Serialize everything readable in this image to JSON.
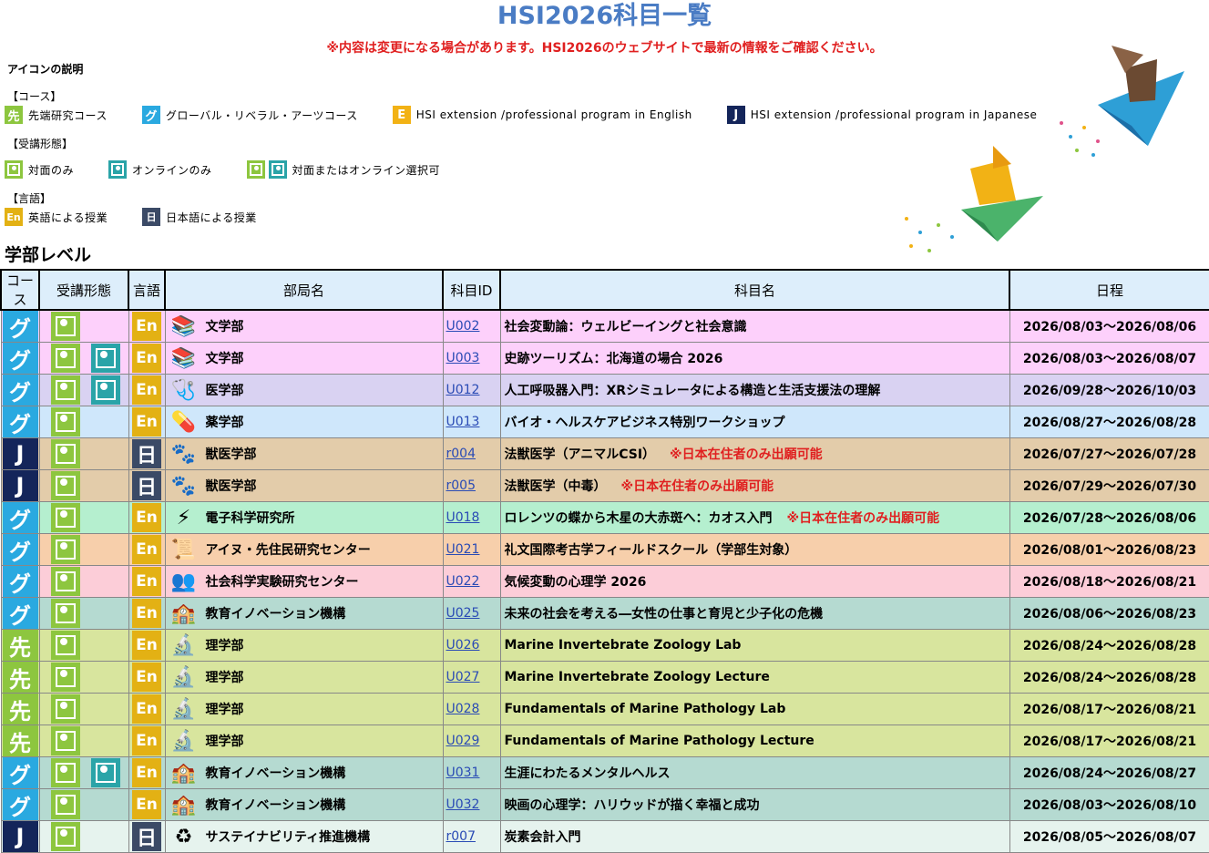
{
  "title": "HSI2026科目一覧",
  "notice": "※内容は変更になる場合があります。HSI2026のウェブサイトで最新の情報をご確認ください。",
  "legend": {
    "heading": "アイコンの説明",
    "course_section": "【コース】",
    "courses": [
      {
        "badge": "先",
        "label": "先端研究コース",
        "color": "#8dc63f"
      },
      {
        "badge": "グ",
        "label": "グローバル・リベラル・アーツコース",
        "color": "#2aa9e0"
      },
      {
        "badge": "E",
        "label": "HSI extension /professional program in English",
        "color": "#f2b215"
      },
      {
        "badge": "J",
        "label": "HSI extension /professional program in Japanese",
        "color": "#14255a"
      }
    ],
    "mode_section": "【受講形態】",
    "modes": [
      {
        "icon": "face-to-face-icon",
        "label": "対面のみ"
      },
      {
        "icon": "online-icon",
        "label": "オンラインのみ"
      },
      {
        "icon": "face-or-online-icon",
        "label": "対面またはオンライン選択可"
      }
    ],
    "lang_section": "【言語】",
    "languages": [
      {
        "badge": "En",
        "label": "英語による授業",
        "color": "#e3b114"
      },
      {
        "badge": "日",
        "label": "日本語による授業",
        "color": "#3b4a66"
      }
    ]
  },
  "section_title": "学部レベル",
  "table": {
    "headers": [
      "コース",
      "受講形態",
      "言語",
      "部局名",
      "科目ID",
      "科目名",
      "日程"
    ],
    "rows": [
      {
        "course": "グ",
        "online": false,
        "lang": "En",
        "dept_icon": "books-icon",
        "dept": "文学部",
        "id": "U002",
        "subject": "社会変動論：ウェルビーイングと社会意識",
        "note": "",
        "date": "2026/08/03～2026/08/06",
        "bg": "#fdd0fb"
      },
      {
        "course": "グ",
        "online": true,
        "lang": "En",
        "dept_icon": "books-icon",
        "dept": "文学部",
        "id": "U003",
        "subject": "史跡ツーリズム：北海道の場合 2026",
        "note": "",
        "date": "2026/08/03～2026/08/07",
        "bg": "#fdd0fb"
      },
      {
        "course": "グ",
        "online": true,
        "lang": "En",
        "dept_icon": "stethoscope-icon",
        "dept": "医学部",
        "id": "U012",
        "subject": "人工呼吸器入門：XRシミュレータによる構造と生活支援法の理解",
        "note": "",
        "date": "2026/09/28～2026/10/03",
        "bg": "#d9d2f2"
      },
      {
        "course": "グ",
        "online": false,
        "lang": "En",
        "dept_icon": "medicine-bottle-icon",
        "dept": "薬学部",
        "id": "U013",
        "subject": "バイオ・ヘルスケアビジネス特別ワークショップ",
        "note": "",
        "date": "2026/08/27～2026/08/28",
        "bg": "#cfe7fb"
      },
      {
        "course": "J",
        "online": false,
        "lang": "日",
        "dept_icon": "paw-icon",
        "dept": "獣医学部",
        "id": "r004",
        "subject": "法獣医学（アニマルCSI）",
        "note": "※日本在住者のみ出願可能",
        "date": "2026/07/27～2026/07/28",
        "bg": "#e3ccaa"
      },
      {
        "course": "J",
        "online": false,
        "lang": "日",
        "dept_icon": "paw-icon",
        "dept": "獣医学部",
        "id": "r005",
        "subject": "法獣医学（中毒）",
        "note": "※日本在住者のみ出願可能",
        "date": "2026/07/29～2026/07/30",
        "bg": "#e3ccaa"
      },
      {
        "course": "グ",
        "online": false,
        "lang": "En",
        "dept_icon": "circuit-icon",
        "dept": "電子科学研究所",
        "id": "U018",
        "subject": "ロレンツの蝶から木星の大赤斑へ：カオス入門",
        "note": "※日本在住者のみ出願可能",
        "date": "2026/07/28～2026/08/06",
        "bg": "#b5efcf"
      },
      {
        "course": "グ",
        "online": false,
        "lang": "En",
        "dept_icon": "scroll-icon",
        "dept": "アイヌ・先住民研究センター",
        "id": "U021",
        "subject": "礼文国際考古学フィールドスクール（学部生対象）",
        "note": "",
        "date": "2026/08/01～2026/08/23",
        "bg": "#f7cfab"
      },
      {
        "course": "グ",
        "online": false,
        "lang": "En",
        "dept_icon": "people-icon",
        "dept": "社会科学実験研究センター",
        "id": "U022",
        "subject": "気候変動の心理学 2026",
        "note": "",
        "date": "2026/08/18～2026/08/21",
        "bg": "#fccdd8"
      },
      {
        "course": "グ",
        "online": false,
        "lang": "En",
        "dept_icon": "school-icon",
        "dept": "教育イノベーション機構",
        "id": "U025",
        "subject": "未来の社会を考える―女性の仕事と育児と少子化の危機",
        "note": "",
        "date": "2026/08/06～2026/08/23",
        "bg": "#b5dad1"
      },
      {
        "course": "先",
        "online": false,
        "lang": "En",
        "dept_icon": "microscope-icon",
        "dept": "理学部",
        "id": "U026",
        "subject": "Marine Invertebrate Zoology Lab",
        "note": "",
        "date": "2026/08/24～2026/08/28",
        "bg": "#d8e59e"
      },
      {
        "course": "先",
        "online": false,
        "lang": "En",
        "dept_icon": "microscope-icon",
        "dept": "理学部",
        "id": "U027",
        "subject": "Marine Invertebrate Zoology Lecture",
        "note": "",
        "date": "2026/08/24～2026/08/28",
        "bg": "#d8e59e"
      },
      {
        "course": "先",
        "online": false,
        "lang": "En",
        "dept_icon": "microscope-icon",
        "dept": "理学部",
        "id": "U028",
        "subject": "Fundamentals of Marine Pathology Lab",
        "note": "",
        "date": "2026/08/17～2026/08/21",
        "bg": "#d8e59e"
      },
      {
        "course": "先",
        "online": false,
        "lang": "En",
        "dept_icon": "microscope-icon",
        "dept": "理学部",
        "id": "U029",
        "subject": "Fundamentals of Marine Pathology Lecture",
        "note": "",
        "date": "2026/08/17～2026/08/21",
        "bg": "#d8e59e"
      },
      {
        "course": "グ",
        "online": true,
        "lang": "En",
        "dept_icon": "school-icon",
        "dept": "教育イノベーション機構",
        "id": "U031",
        "subject": "生涯にわたるメンタルヘルス",
        "note": "",
        "date": "2026/08/24～2026/08/27",
        "bg": "#b5dad1"
      },
      {
        "course": "グ",
        "online": false,
        "lang": "En",
        "dept_icon": "school-icon",
        "dept": "教育イノベーション機構",
        "id": "U032",
        "subject": "映画の心理学：ハリウッドが描く幸福と成功",
        "note": "",
        "date": "2026/08/03～2026/08/10",
        "bg": "#b5dad1"
      },
      {
        "course": "J",
        "online": false,
        "lang": "日",
        "dept_icon": "recycle-icon",
        "dept": "サステイナビリティ推進機構",
        "id": "r007",
        "subject": "炭素会計入門",
        "note": "",
        "date": "2026/08/05～2026/08/07",
        "bg": "#e6f3ee"
      }
    ]
  }
}
